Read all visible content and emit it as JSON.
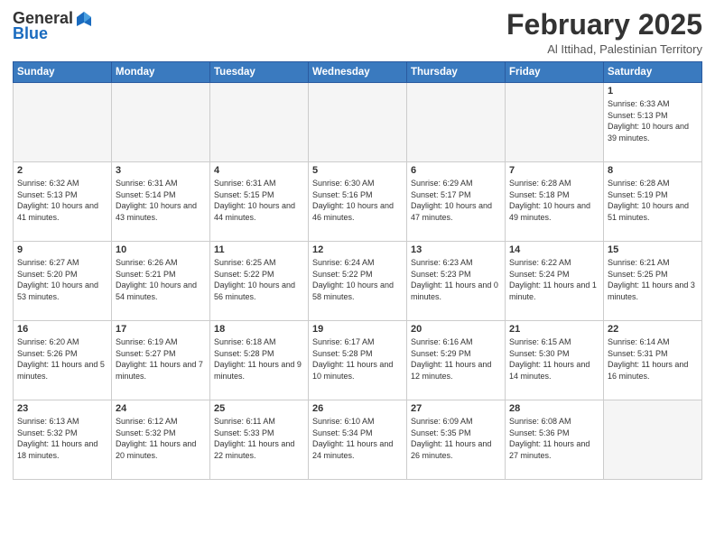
{
  "logo": {
    "general": "General",
    "blue": "Blue"
  },
  "header": {
    "month": "February 2025",
    "location": "Al Ittihad, Palestinian Territory"
  },
  "days": [
    "Sunday",
    "Monday",
    "Tuesday",
    "Wednesday",
    "Thursday",
    "Friday",
    "Saturday"
  ],
  "weeks": [
    [
      {
        "day": "",
        "info": ""
      },
      {
        "day": "",
        "info": ""
      },
      {
        "day": "",
        "info": ""
      },
      {
        "day": "",
        "info": ""
      },
      {
        "day": "",
        "info": ""
      },
      {
        "day": "",
        "info": ""
      },
      {
        "day": "1",
        "info": "Sunrise: 6:33 AM\nSunset: 5:13 PM\nDaylight: 10 hours and 39 minutes."
      }
    ],
    [
      {
        "day": "2",
        "info": "Sunrise: 6:32 AM\nSunset: 5:13 PM\nDaylight: 10 hours and 41 minutes."
      },
      {
        "day": "3",
        "info": "Sunrise: 6:31 AM\nSunset: 5:14 PM\nDaylight: 10 hours and 43 minutes."
      },
      {
        "day": "4",
        "info": "Sunrise: 6:31 AM\nSunset: 5:15 PM\nDaylight: 10 hours and 44 minutes."
      },
      {
        "day": "5",
        "info": "Sunrise: 6:30 AM\nSunset: 5:16 PM\nDaylight: 10 hours and 46 minutes."
      },
      {
        "day": "6",
        "info": "Sunrise: 6:29 AM\nSunset: 5:17 PM\nDaylight: 10 hours and 47 minutes."
      },
      {
        "day": "7",
        "info": "Sunrise: 6:28 AM\nSunset: 5:18 PM\nDaylight: 10 hours and 49 minutes."
      },
      {
        "day": "8",
        "info": "Sunrise: 6:28 AM\nSunset: 5:19 PM\nDaylight: 10 hours and 51 minutes."
      }
    ],
    [
      {
        "day": "9",
        "info": "Sunrise: 6:27 AM\nSunset: 5:20 PM\nDaylight: 10 hours and 53 minutes."
      },
      {
        "day": "10",
        "info": "Sunrise: 6:26 AM\nSunset: 5:21 PM\nDaylight: 10 hours and 54 minutes."
      },
      {
        "day": "11",
        "info": "Sunrise: 6:25 AM\nSunset: 5:22 PM\nDaylight: 10 hours and 56 minutes."
      },
      {
        "day": "12",
        "info": "Sunrise: 6:24 AM\nSunset: 5:22 PM\nDaylight: 10 hours and 58 minutes."
      },
      {
        "day": "13",
        "info": "Sunrise: 6:23 AM\nSunset: 5:23 PM\nDaylight: 11 hours and 0 minutes."
      },
      {
        "day": "14",
        "info": "Sunrise: 6:22 AM\nSunset: 5:24 PM\nDaylight: 11 hours and 1 minute."
      },
      {
        "day": "15",
        "info": "Sunrise: 6:21 AM\nSunset: 5:25 PM\nDaylight: 11 hours and 3 minutes."
      }
    ],
    [
      {
        "day": "16",
        "info": "Sunrise: 6:20 AM\nSunset: 5:26 PM\nDaylight: 11 hours and 5 minutes."
      },
      {
        "day": "17",
        "info": "Sunrise: 6:19 AM\nSunset: 5:27 PM\nDaylight: 11 hours and 7 minutes."
      },
      {
        "day": "18",
        "info": "Sunrise: 6:18 AM\nSunset: 5:28 PM\nDaylight: 11 hours and 9 minutes."
      },
      {
        "day": "19",
        "info": "Sunrise: 6:17 AM\nSunset: 5:28 PM\nDaylight: 11 hours and 10 minutes."
      },
      {
        "day": "20",
        "info": "Sunrise: 6:16 AM\nSunset: 5:29 PM\nDaylight: 11 hours and 12 minutes."
      },
      {
        "day": "21",
        "info": "Sunrise: 6:15 AM\nSunset: 5:30 PM\nDaylight: 11 hours and 14 minutes."
      },
      {
        "day": "22",
        "info": "Sunrise: 6:14 AM\nSunset: 5:31 PM\nDaylight: 11 hours and 16 minutes."
      }
    ],
    [
      {
        "day": "23",
        "info": "Sunrise: 6:13 AM\nSunset: 5:32 PM\nDaylight: 11 hours and 18 minutes."
      },
      {
        "day": "24",
        "info": "Sunrise: 6:12 AM\nSunset: 5:32 PM\nDaylight: 11 hours and 20 minutes."
      },
      {
        "day": "25",
        "info": "Sunrise: 6:11 AM\nSunset: 5:33 PM\nDaylight: 11 hours and 22 minutes."
      },
      {
        "day": "26",
        "info": "Sunrise: 6:10 AM\nSunset: 5:34 PM\nDaylight: 11 hours and 24 minutes."
      },
      {
        "day": "27",
        "info": "Sunrise: 6:09 AM\nSunset: 5:35 PM\nDaylight: 11 hours and 26 minutes."
      },
      {
        "day": "28",
        "info": "Sunrise: 6:08 AM\nSunset: 5:36 PM\nDaylight: 11 hours and 27 minutes."
      },
      {
        "day": "",
        "info": ""
      }
    ]
  ]
}
